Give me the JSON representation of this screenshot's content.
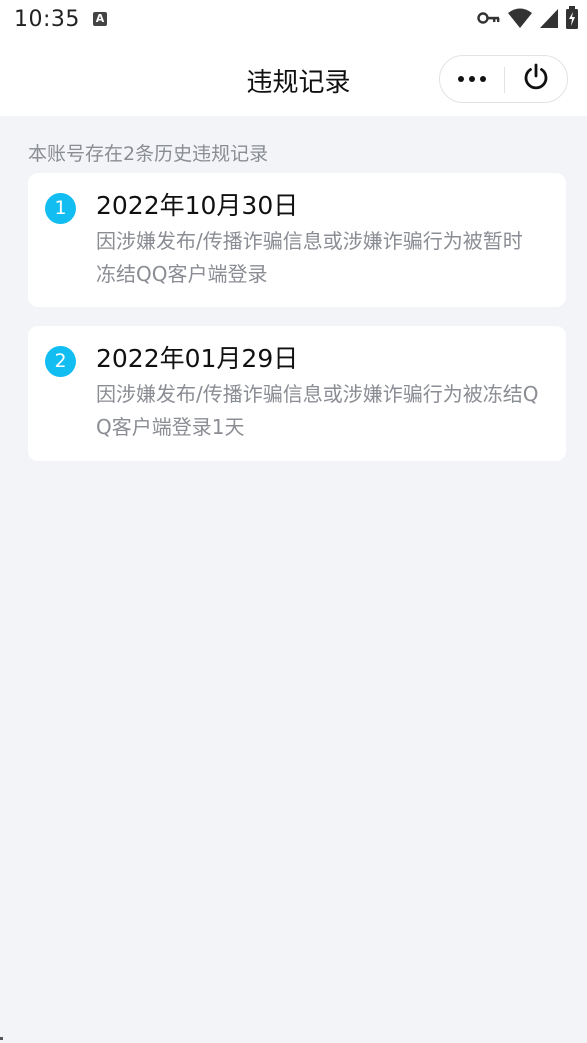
{
  "status_bar": {
    "time": "10:35",
    "notification_icon": "A",
    "icons": [
      "key-icon",
      "wifi-icon",
      "signal-icon",
      "battery-icon"
    ]
  },
  "header": {
    "title": "违规记录"
  },
  "summary": "本账号存在2条历史违规记录",
  "records": [
    {
      "index": "1",
      "date": "2022年10月30日",
      "description": "因涉嫌发布/传播诈骗信息或涉嫌诈骗行为被暂时冻结QQ客户端登录"
    },
    {
      "index": "2",
      "date": "2022年01月29日",
      "description": "因涉嫌发布/传播诈骗信息或涉嫌诈骗行为被冻结QQ客户端登录1天"
    }
  ],
  "colors": {
    "accent": "#12bdf2",
    "background": "#f3f4f8",
    "card": "#ffffff",
    "muted_text": "#8a8d93"
  }
}
